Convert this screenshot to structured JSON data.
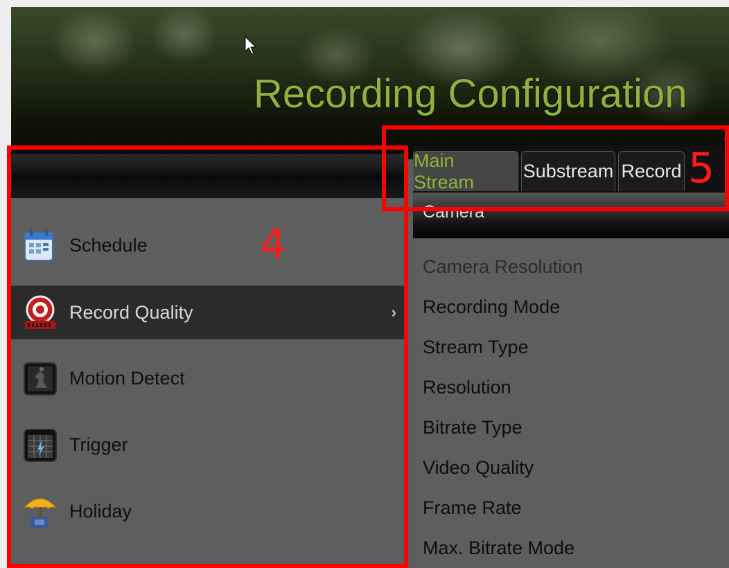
{
  "header": {
    "title": "Recording Configuration"
  },
  "menu": {
    "items": [
      {
        "label": "Schedule",
        "icon": "calendar-icon",
        "active": false
      },
      {
        "label": "Record Quality",
        "icon": "record-icon",
        "active": true
      },
      {
        "label": "Motion Detect",
        "icon": "motion-detect-icon",
        "active": false
      },
      {
        "label": "Trigger",
        "icon": "trigger-icon",
        "active": false
      },
      {
        "label": "Holiday",
        "icon": "umbrella-icon",
        "active": false
      }
    ],
    "active_arrow": "›"
  },
  "tabs": [
    {
      "label": "Main Stream",
      "active": true
    },
    {
      "label": "Substream",
      "active": false
    },
    {
      "label": "Record",
      "active": false
    }
  ],
  "section": {
    "label": "Camera"
  },
  "fields": [
    "Camera Resolution",
    "Recording Mode",
    "Stream Type",
    "Resolution",
    "Bitrate Type",
    "Video Quality",
    "Frame Rate",
    "Max. Bitrate Mode"
  ],
  "annotations": {
    "left_number": "4",
    "right_number": "5"
  },
  "colors": {
    "accent": "#8fb23a",
    "annotation": "#ff0000"
  }
}
